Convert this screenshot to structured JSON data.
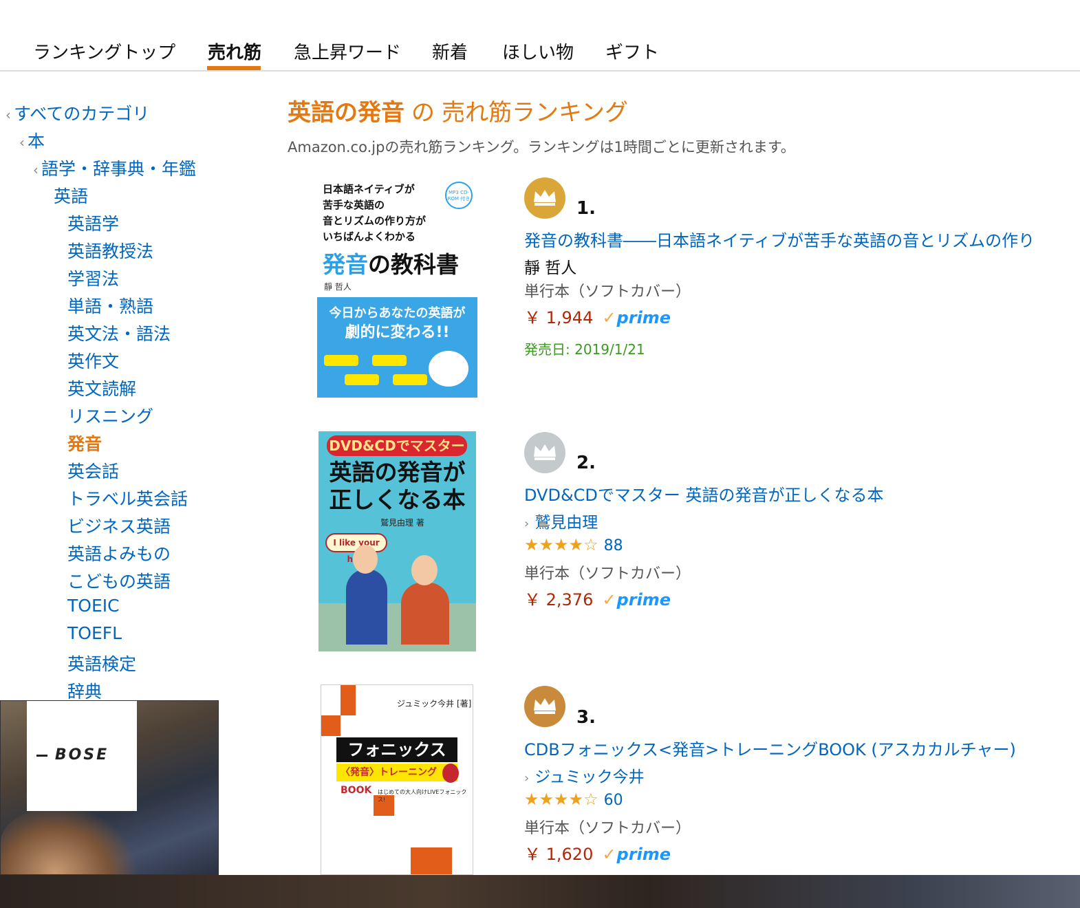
{
  "tabs": [
    {
      "label": "ランキングトップ"
    },
    {
      "label": "売れ筋"
    },
    {
      "label": "急上昇ワード"
    },
    {
      "label": "新着"
    },
    {
      "label": "ほしい物"
    },
    {
      "label": "ギフト"
    }
  ],
  "active_tab": "売れ筋",
  "sidebar": {
    "ancestors": [
      "すべてのカテゴリ",
      "本",
      "語学・辞事典・年鑑"
    ],
    "parent": "英語",
    "items": [
      "英語学",
      "英語教授法",
      "学習法",
      "単語・熟語",
      "英文法・語法",
      "英作文",
      "英文読解",
      "リスニング",
      "発音",
      "英会話",
      "トラベル英会話",
      "ビジネス英語",
      "英語よみもの",
      "こどもの英語",
      "TOEIC",
      "TOEFL",
      "英語検定",
      "辞典"
    ],
    "current": "発音"
  },
  "ad": {
    "brand": "BOSE"
  },
  "header": {
    "category": "英語の発音",
    "joiner": "の",
    "suffix": "売れ筋ランキング",
    "subtitle": "Amazon.co.jpの売れ筋ランキング。ランキングは1時間ごとに更新されます。"
  },
  "items": [
    {
      "rank": "1.",
      "badge": "gold",
      "title": "発音の教科書――日本語ネイティブが苦手な英語の音とリズムの作り",
      "author": "靜 哲人",
      "format": "単行本（ソフトカバー）",
      "price": "￥ 1,944",
      "prime": "prime",
      "release": "発売日: 2019/1/21",
      "cover": {
        "lines": [
          "日本語ネイティブが",
          "苦手な英語の",
          "音とリズムの作り方が",
          "いちばんよくわかる"
        ],
        "big_hl": "発音",
        "big_rest": "の教科書",
        "author": "靜 哲人",
        "badge": "MP3 CD-ROM 付き",
        "band_1": "今日からあなたの英語が",
        "band_2": "劇的に変わる!!"
      }
    },
    {
      "rank": "2.",
      "badge": "silver",
      "title": "DVD&CDでマスター 英語の発音が正しくなる本",
      "author": "鷲見由理",
      "stars": 4,
      "reviews": "88",
      "format": "単行本（ソフトカバー）",
      "price": "￥ 2,376",
      "prime": "prime",
      "cover": {
        "pill": "DVD&CDでマスター",
        "big_1": "英語の発音が",
        "big_2": "正しくなる本",
        "author": "鷲見由理 著",
        "bubble": "I like your hat."
      }
    },
    {
      "rank": "3.",
      "badge": "bronze",
      "title": "CDBフォニックス<発音>トレーニングBOOK (アスカカルチャー)",
      "author": "ジュミック今井",
      "stars": 4,
      "reviews": "60",
      "format": "単行本（ソフトカバー）",
      "price": "￥ 1,620",
      "prime": "prime",
      "cover": {
        "author": "ジュミック今井 [著]",
        "bar": "フォニックス",
        "sub": "〈発音〉トレーニングBOOK",
        "tagline": "はじめての大人向けLIVEフォニックス!"
      }
    }
  ],
  "colors": {
    "accent": "#e47911",
    "link": "#0066c0",
    "price": "#b12704",
    "release": "#3a9a1e",
    "gold": "#d9a637",
    "silver": "#c4c9cc",
    "bronze": "#c98a3c"
  }
}
